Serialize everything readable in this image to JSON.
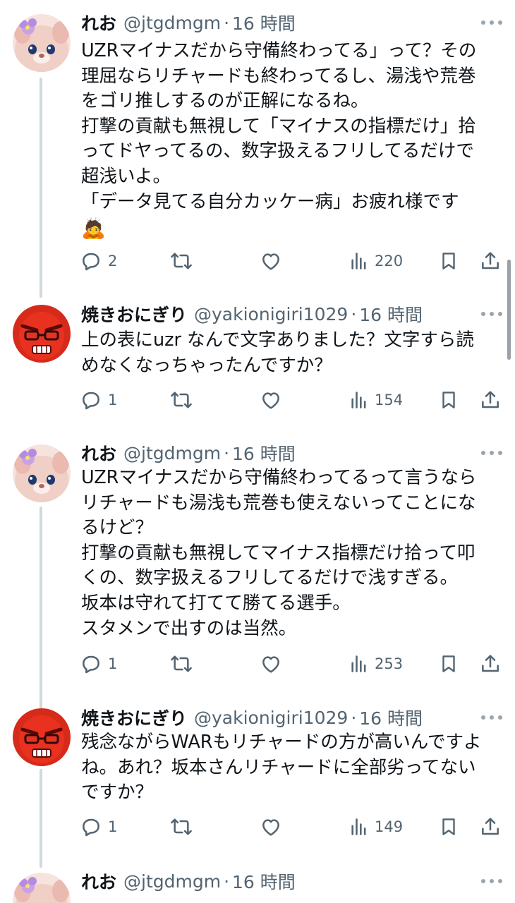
{
  "tweets": [
    {
      "name": "れお",
      "handle": "@jtgdmgm",
      "dot": "·",
      "time": "16 時間",
      "lines": [
        "UZRマイナスだから守備終わってる」って？その",
        "理屈ならリチャードも終わってるし、湯浅や荒巻",
        "をゴリ推しするのが正解になるね。",
        "打撃の貢献も無視して「マイナスの指標だけ」拾",
        "ってドヤってるの、数字扱えるフリしてるだけで",
        "超浅いよ。",
        "「データ見てる自分カッケー病」お疲れ様です"
      ],
      "emoji": "🙇",
      "replies": "2",
      "views": "220"
    },
    {
      "name": "焼きおにぎり",
      "handle": "@yakionigiri1029",
      "dot": "·",
      "time": "16 時間",
      "lines": [
        "上の表にuzr なんで文字ありました？文字すら読",
        "めなくなっちゃったんですか？"
      ],
      "replies": "1",
      "views": "154"
    },
    {
      "name": "れお",
      "handle": "@jtgdmgm",
      "dot": "·",
      "time": "16 時間",
      "lines": [
        "UZRマイナスだから守備終わってるって言うなら",
        "リチャードも湯浅も荒巻も使えないってことにな",
        "るけど？",
        "打撃の貢献も無視してマイナス指標だけ拾って叩",
        "くの、数字扱えるフリしてるだけで浅すぎる。",
        "坂本は守れて打てて勝てる選手。",
        "スタメンで出すのは当然。"
      ],
      "replies": "1",
      "views": "253"
    },
    {
      "name": "焼きおにぎり",
      "handle": "@yakionigiri1029",
      "dot": "·",
      "time": "16 時間",
      "lines": [
        "残念ながらWARもリチャードの方が高いんですよ",
        "ね。あれ？坂本さんリチャードに全部劣ってない",
        "ですか？"
      ],
      "replies": "1",
      "views": "149"
    },
    {
      "name": "れお",
      "handle": "@jtgdmgm",
      "dot": "·",
      "time": "16 時間",
      "lines": []
    }
  ],
  "colors": {
    "text": "#0f1419",
    "secondary": "#536471",
    "thread": "#cfd9de",
    "action": "#536471"
  },
  "icons": [
    "reply-icon",
    "retweet-icon",
    "like-icon",
    "views-icon",
    "bookmark-icon",
    "share-icon",
    "more-icon"
  ]
}
